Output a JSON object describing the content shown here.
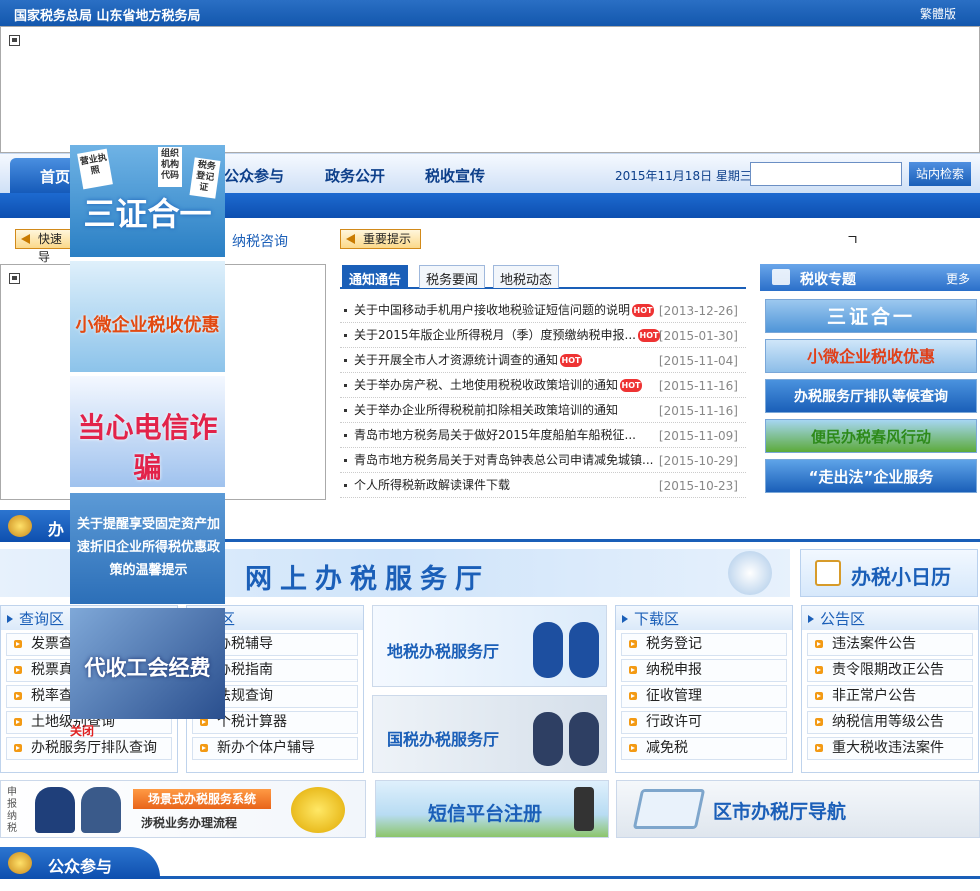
{
  "header": {
    "site_title": "国家税务总局 山东省地方税务局",
    "traditional": "繁體版"
  },
  "nav": {
    "items": [
      "首页",
      "公众参与",
      "政务公开",
      "税收宣传"
    ],
    "date": "2015年11月18日  星期三",
    "search_placeholder": "",
    "search_button": "站内检索"
  },
  "quick": {
    "guide": "快速导",
    "consult": "纳税咨询",
    "notice": "重要提示",
    "misc": "ㄱ"
  },
  "news": {
    "tabs": [
      "通知通告",
      "税务要闻",
      "地税动态"
    ],
    "items": [
      {
        "title": "关于中国移动手机用户接收地税验证短信问题的说明",
        "date": "[2013-12-26]",
        "hot": true
      },
      {
        "title": "关于2015年版企业所得税月（季）度预缴纳税申报...",
        "date": "[2015-01-30]",
        "hot": true
      },
      {
        "title": "关于开展全市人才资源统计调查的通知",
        "date": "[2015-11-04]",
        "hot": true
      },
      {
        "title": "关于举办房产税、土地使用税税收政策培训的通知",
        "date": "[2015-11-16]",
        "hot": true
      },
      {
        "title": "关于举办企业所得税税前扣除相关政策培训的通知",
        "date": "[2015-11-16]",
        "hot": false
      },
      {
        "title": "青岛市地方税务局关于做好2015年度船舶车船税征...",
        "date": "[2015-11-09]",
        "hot": false
      },
      {
        "title": "青岛市地方税务局关于对青岛钟表总公司申请减免城镇...",
        "date": "[2015-10-29]",
        "hot": false
      },
      {
        "title": "个人所得税新政解读课件下载",
        "date": "[2015-10-23]",
        "hot": false
      }
    ],
    "hot_label": "HOT"
  },
  "special": {
    "title": "税收专题",
    "more": "更多",
    "banners": [
      "三证合一",
      "小微企业税收优惠",
      "办税服务厅排队等候查询",
      "便民办税春风行动",
      "“走出法”企业服务"
    ]
  },
  "sections": {
    "banshui": "办",
    "gongzhong": "公众参与"
  },
  "hall": {
    "title": "网上办税服务厅",
    "calendar": "办税小日历"
  },
  "query": {
    "title": "查询区",
    "items": [
      "发票查",
      "税票真",
      "税率查",
      "土地级别查询",
      "办税服务厅排队查询"
    ]
  },
  "guide_box": {
    "title": "导区",
    "items": [
      "办税辅导",
      "办税指南",
      "法规查询",
      "个税计算器",
      "新办个体户辅导"
    ]
  },
  "mid_banners": {
    "local": "地税办税服务厅",
    "national": "国税办税服务厅"
  },
  "download": {
    "title": "下载区",
    "items": [
      "税务登记",
      "纳税申报",
      "征收管理",
      "行政许可",
      "减免税"
    ]
  },
  "announce": {
    "title": "公告区",
    "items": [
      "违法案件公告",
      "责令限期改正公告",
      "非正常户公告",
      "纳税信用等级公告",
      "重大税收违法案件"
    ]
  },
  "floats": {
    "f1": "三证合一",
    "f1_cards": [
      "营业执照",
      "组织机构代码",
      "税务登记证"
    ],
    "f2": "小微企业税收优惠",
    "f3": "当心电信诈骗",
    "f4": "关于提醒享受固定资产加速折旧企业所得税优惠政策的温馨提示",
    "f5": "代收工会经费",
    "close": "关闭"
  },
  "bottom": {
    "b1_side": "申报纳税",
    "b1_title": "场景式办税服务系统",
    "b1_sub": "涉税业务办理流程",
    "b2": "短信平台注册",
    "b3": "区市办税厅导航"
  }
}
